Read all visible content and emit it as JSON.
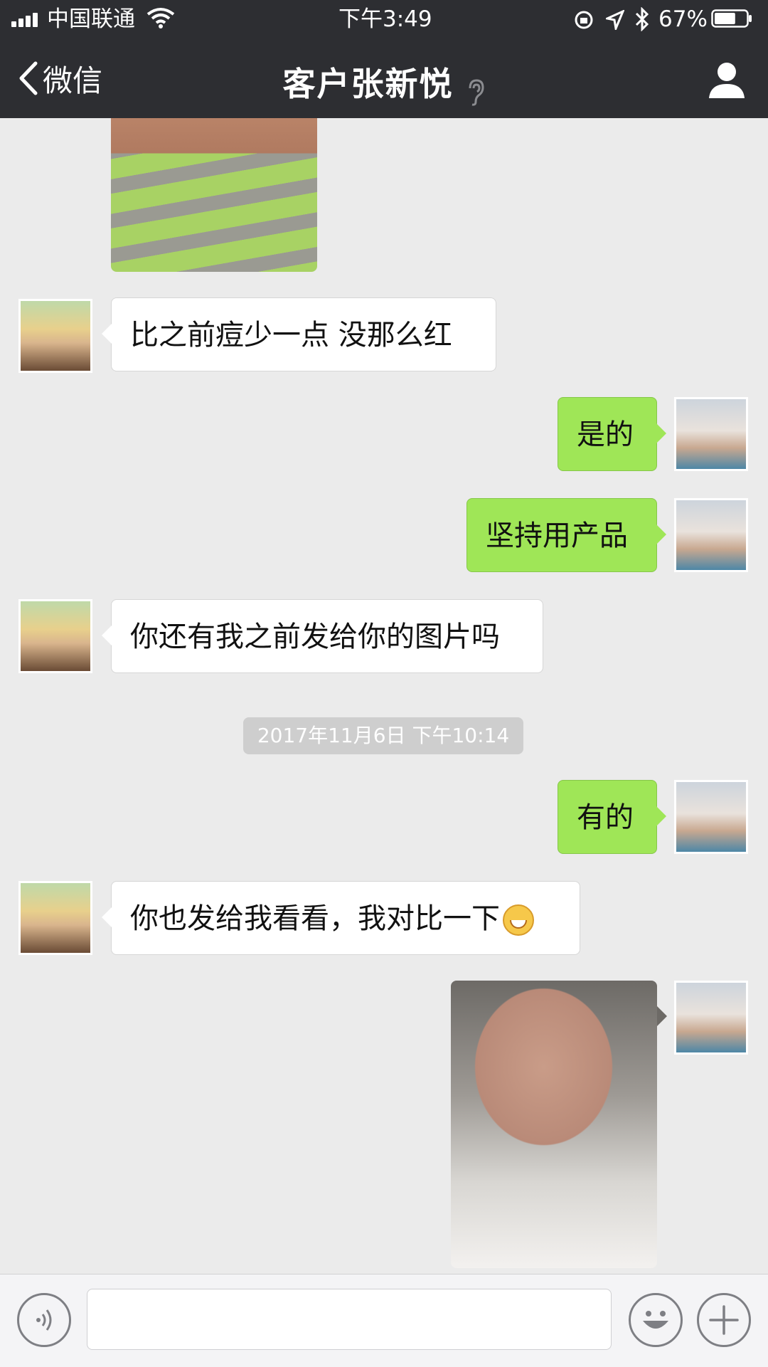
{
  "status_bar": {
    "carrier": "中国联通",
    "time": "下午3:49",
    "battery": "67%",
    "battery_level": 0.67
  },
  "nav": {
    "back_label": "微信",
    "title": "客户张新悦",
    "icons": [
      "chevron-left-icon",
      "ear-icon",
      "person-icon"
    ]
  },
  "messages": [
    {
      "side": "incoming",
      "type": "image",
      "description_icon": "photo"
    },
    {
      "side": "incoming",
      "type": "text",
      "text": "比之前痘少一点  没那么红"
    },
    {
      "side": "outgoing",
      "type": "text",
      "text": "是的"
    },
    {
      "side": "outgoing",
      "type": "text",
      "text": "坚持用产品"
    },
    {
      "side": "incoming",
      "type": "text",
      "text": "你还有我之前发给你的图片吗"
    },
    {
      "type": "timestamp",
      "text": "2017年11月6日 下午10:14"
    },
    {
      "side": "outgoing",
      "type": "text",
      "text": "有的"
    },
    {
      "side": "incoming",
      "type": "text",
      "text": "你也发给我看看，我对比一下",
      "emoji": "grinning-face-icon"
    },
    {
      "side": "outgoing",
      "type": "image",
      "description_icon": "photo"
    }
  ],
  "input_bar": {
    "value": "",
    "icons": [
      "voice-icon",
      "emoji-icon",
      "plus-icon"
    ]
  },
  "colors": {
    "nav_bg": "#2d2e32",
    "chat_bg": "#ebebeb",
    "outgoing_bubble": "#9fe657",
    "incoming_bubble": "#ffffff",
    "timestamp_chip": "#cecece"
  }
}
